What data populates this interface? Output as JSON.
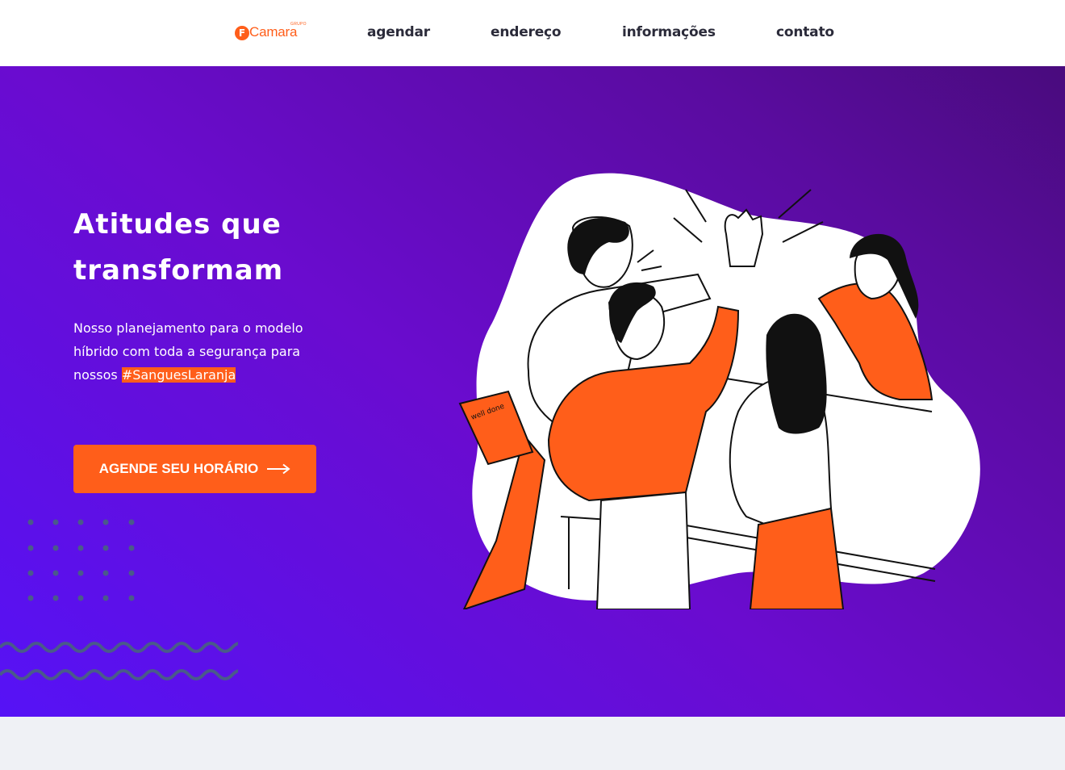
{
  "brand": {
    "logo_letter": "F",
    "logo_word": "Camara",
    "logo_tag": "GRUPO"
  },
  "nav": {
    "links": [
      "agendar",
      "endereço",
      "informações",
      "contato"
    ]
  },
  "hero": {
    "title": "Atitudes que transformam",
    "subtitle_text": "Nosso planejamento para o modelo híbrido com toda a segurança para nossos ",
    "hashtag": "#SanguesLaranja",
    "cta_label": "AGENDE SEU HORÁRIO",
    "illustration_note": "well done",
    "colors": {
      "accent": "#ff5e1a",
      "gradient_start": "#5612f6",
      "gradient_end": "#490b7d",
      "decor": "#4a5a8a"
    }
  },
  "icons": {
    "cta": "arrow-right-icon",
    "illustration": "team-high-five-illustration"
  }
}
